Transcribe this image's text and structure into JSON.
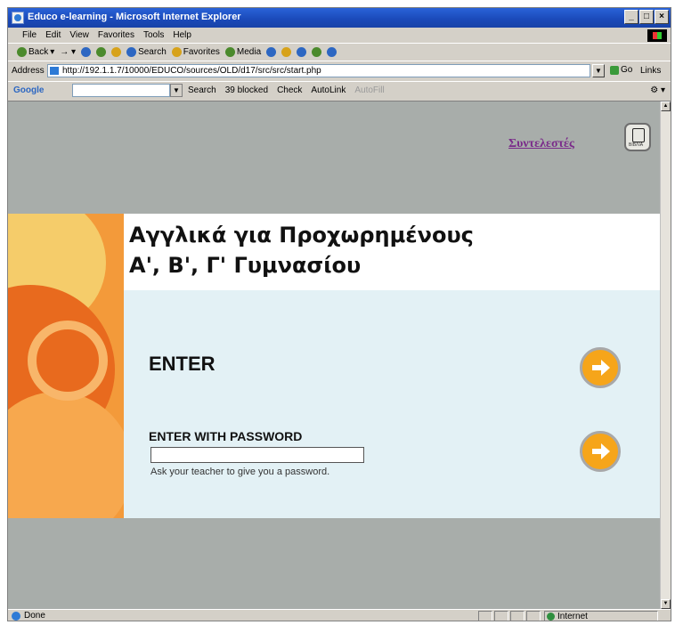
{
  "window": {
    "title": "Educo e-learning - Microsoft Internet Explorer",
    "controls": [
      "_",
      "□",
      "×"
    ]
  },
  "menu": [
    "File",
    "Edit",
    "View",
    "Favorites",
    "Tools",
    "Help"
  ],
  "toolbar": {
    "back": "Back",
    "search": "Search",
    "favorites": "Favorites",
    "media": "Media"
  },
  "address": {
    "label": "Address",
    "url": "http://192.1.1.7/10000/EDUCO/sources/OLD/d17/src/src/start.php",
    "go": "Go",
    "links": "Links"
  },
  "googlebar": {
    "logo": "Google",
    "search": "Search",
    "blocked": "39 blocked",
    "check": "Check",
    "autolink": "AutoLink",
    "autofill": "AutoFill"
  },
  "page": {
    "credits_link": "Συντελεστές",
    "credits_icon_caption": "ΒΙΒΛΙΑ",
    "title_line1": "Αγγλικά για Προχωρημένους",
    "title_line2": "Α', Β', Γ' Γυμνασίου",
    "enter_label": "ENTER",
    "enter_password_label": "ENTER WITH PASSWORD",
    "password_value": "",
    "password_hint": "Ask your teacher to give you a password."
  },
  "status": {
    "text": "Done",
    "zone": "Internet"
  },
  "colors": {
    "accent_orange": "#f6a51a",
    "background_gray": "#a8adaa",
    "panel_blue": "#e3f1f5",
    "credits_link": "#7a2b8a"
  }
}
